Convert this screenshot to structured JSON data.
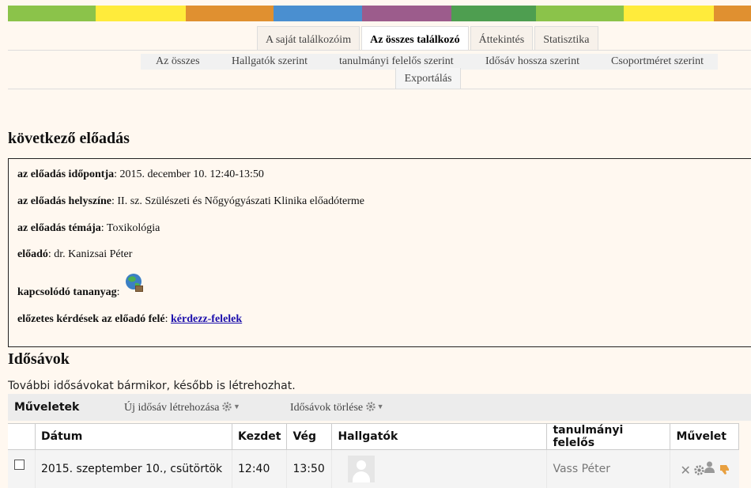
{
  "colorbar": [
    "#8bc34a",
    "#ffeb3b",
    "#e09030",
    "#4a8fd0",
    "#9c5c8c",
    "#4e9e50",
    "#8bc34a",
    "#ffeb3b",
    "#e09030"
  ],
  "tabs": [
    {
      "label": "A saját találkozóim",
      "active": false
    },
    {
      "label": "Az összes találkozó",
      "active": true
    },
    {
      "label": "Áttekintés",
      "active": false
    },
    {
      "label": "Statisztika",
      "active": false
    }
  ],
  "subtabs": [
    "Az összes",
    "Hallgatók szerint",
    "tanulmányi felelős szerint",
    "Idősáv hossza szerint",
    "Csoportméret szerint"
  ],
  "export_label": "Exportálás",
  "lecture": {
    "heading": "következő előadás",
    "time_label": "az előadás időpontja",
    "time_value": ": 2015. december 10. 12:40-13:50",
    "place_label": "az előadás helyszíne",
    "place_value": ": II. sz. Szülészeti és Nőgyógyászati Klinika előadóterme",
    "topic_label": "az előadás témája",
    "topic_value": ": Toxikológia",
    "speaker_label": "előadó",
    "speaker_value": ": dr. Kanizsai Péter",
    "material_label": "kapcsolódó tananyag",
    "material_value": ":",
    "questions_label": "előzetes kérdések az előadó felé",
    "questions_colon": ":",
    "questions_link": "kérdezz-felelek"
  },
  "slots": {
    "heading": "Idősávok",
    "hint": "További idősávokat bármikor, később is létrehozhat.",
    "actions_label": "Műveletek",
    "new_slot": "Új idősáv létrehozása",
    "delete_slots": "Idősávok törlése",
    "columns": [
      "Dátum",
      "Kezdet",
      "Vég",
      "Hallgatók",
      "tanulmányi felelős",
      "Művelet"
    ],
    "rows": [
      {
        "date": "2015. szeptember 10., csütörtök",
        "start": "12:40",
        "end": "13:50",
        "teacher": "Vass Péter"
      }
    ]
  }
}
